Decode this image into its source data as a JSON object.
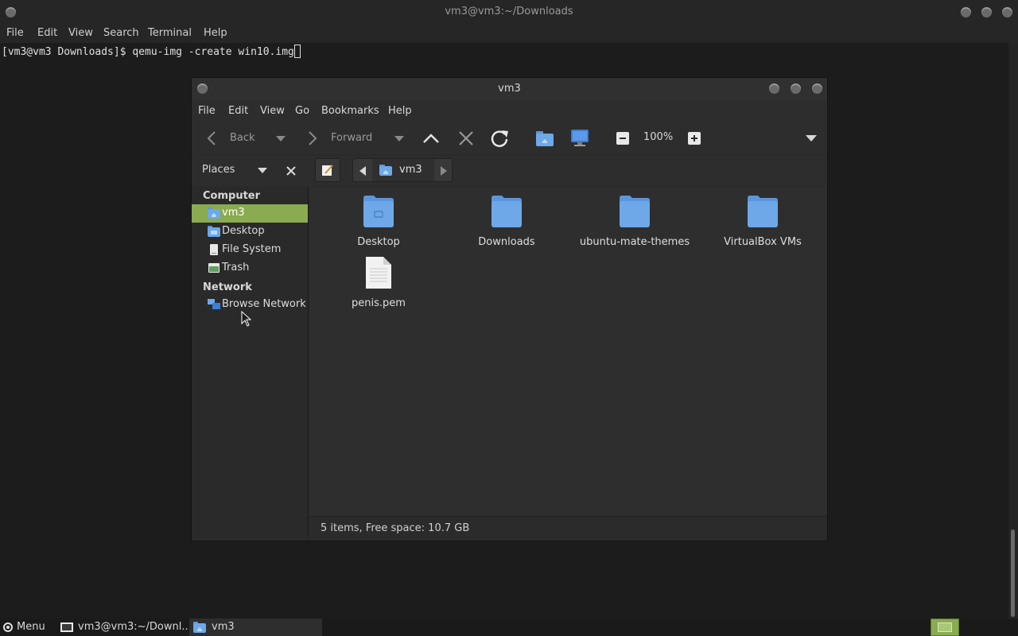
{
  "terminal": {
    "title": "vm3@vm3:~/Downloads",
    "menu": [
      "File",
      "Edit",
      "View",
      "Search",
      "Terminal",
      "Help"
    ],
    "prompt_line": "[vm3@vm3 Downloads]$ qemu-img -create win10.img"
  },
  "file_manager": {
    "title": "vm3",
    "menu": [
      "File",
      "Edit",
      "View",
      "Go",
      "Bookmarks",
      "Help"
    ],
    "toolbar": {
      "back_label": "Back",
      "forward_label": "Forward",
      "zoom_level": "100%"
    },
    "sidebar_title": "Places",
    "location": "vm3",
    "sidebar": {
      "computer_heading": "Computer",
      "network_heading": "Network",
      "computer_items": [
        {
          "label": "vm3",
          "icon": "home-folder-icon",
          "selected": true
        },
        {
          "label": "Desktop",
          "icon": "desktop-folder-icon",
          "selected": false
        },
        {
          "label": "File System",
          "icon": "drive-icon",
          "selected": false
        },
        {
          "label": "Trash",
          "icon": "trash-icon",
          "selected": false
        }
      ],
      "network_items": [
        {
          "label": "Browse Network",
          "icon": "network-icon",
          "selected": false
        }
      ]
    },
    "files": [
      {
        "name": "Desktop",
        "type": "folder"
      },
      {
        "name": "Downloads",
        "type": "folder"
      },
      {
        "name": "ubuntu-mate-themes",
        "type": "folder"
      },
      {
        "name": "VirtualBox VMs",
        "type": "folder"
      },
      {
        "name": "penis.pem",
        "type": "file"
      }
    ],
    "status": "5 items, Free space: 10.7 GB"
  },
  "taskbar": {
    "menu_label": "Menu",
    "tasks": [
      {
        "label": "vm3@vm3:~/Downl...",
        "icon": "terminal-icon",
        "active": false
      },
      {
        "label": "vm3",
        "icon": "home-folder-icon",
        "active": true
      }
    ]
  },
  "colors": {
    "accent": "#8aab4f",
    "folder": "#6ea8e8"
  }
}
